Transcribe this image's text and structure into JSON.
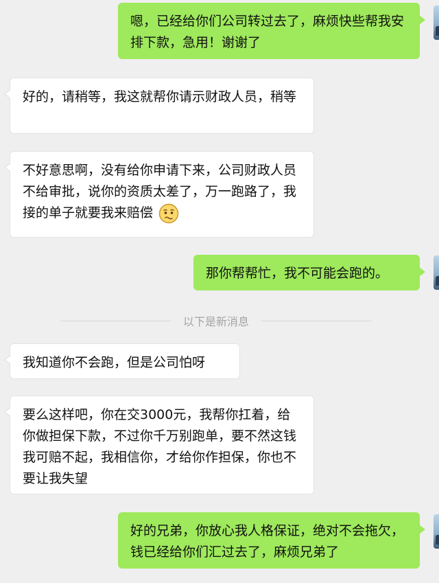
{
  "messages": [
    {
      "side": "out",
      "text": "嗯，已经给你们公司转过去了，麻烦快些帮我安排下款，急用！谢谢了"
    },
    {
      "side": "in",
      "text": "好的，请稍等，我这就帮你请示财政人员，稍等"
    },
    {
      "side": "in",
      "text": "不好意思啊，没有给你申请下来，公司财政人员不给审批，说你的资质太差了，万一跑路了，我接的单子就要我来赔偿",
      "emoji": "worried-face-emoji"
    },
    {
      "side": "out",
      "text": "那你帮帮忙，我不可能会跑的。"
    },
    {
      "side": "in",
      "text": "我知道你不会跑，但是公司怕呀"
    },
    {
      "side": "in",
      "text": "要么这样吧，你在交3000元，我帮你扛着，给你做担保下款，不过你千万别跑单，要不然这钱我可赔不起，我相信你，才给你作担保，你也不要让我失望"
    },
    {
      "side": "out",
      "text": "好的兄弟，你放心我人格保证，绝对不会拖欠，钱已经给你们汇过去了，麻烦兄弟了"
    }
  ],
  "divider": {
    "label": "以下是新消息"
  },
  "colors": {
    "outgoing_bubble": "#9ee95c",
    "incoming_bubble": "#ffffff",
    "background": "#efefef",
    "divider_text": "#a4a4a4"
  }
}
